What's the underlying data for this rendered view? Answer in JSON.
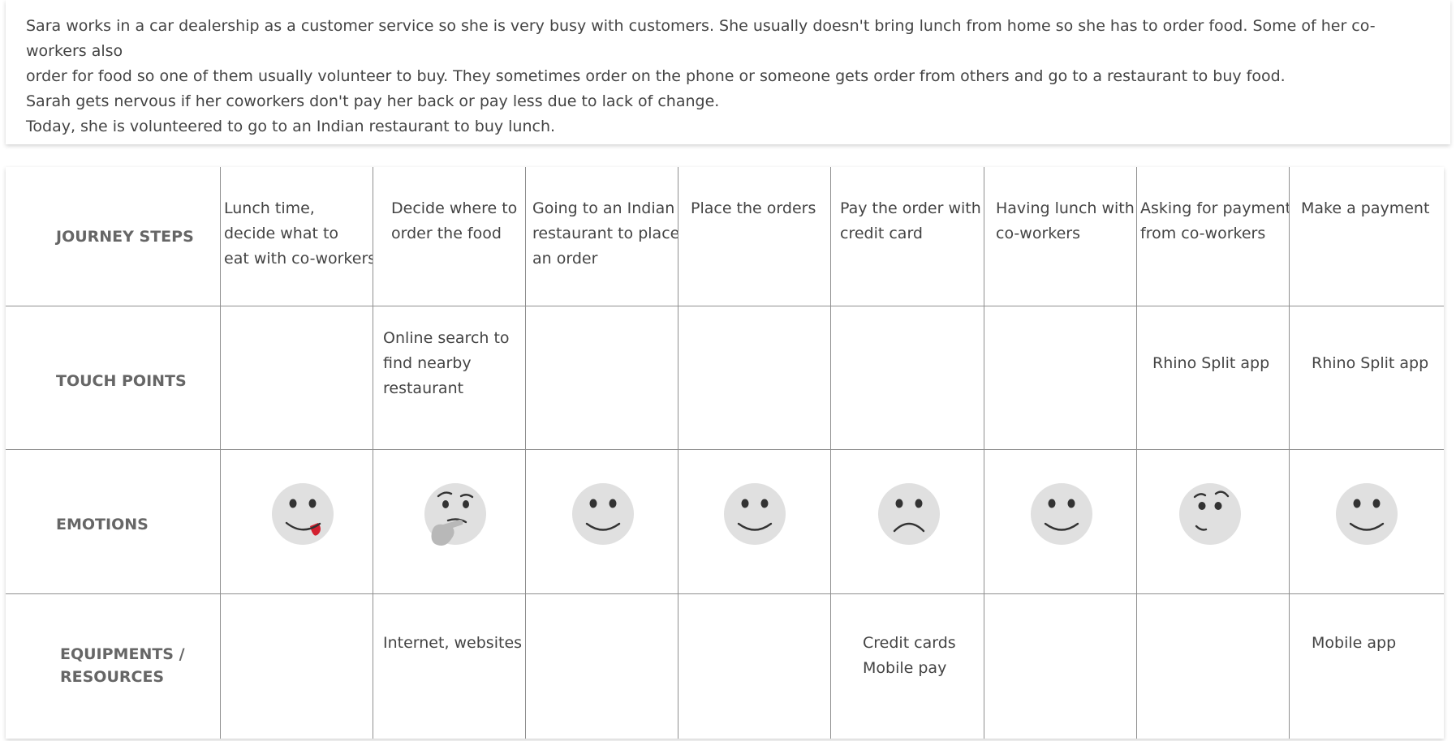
{
  "scenario": {
    "lines": [
      "Sara works in a car dealership as a customer service so she is very busy with customers. She usually doesn't bring lunch from home so she has to order food. Some of her co-workers also",
      "order for food so one of them usually volunteer to buy. They sometimes order on the phone or someone gets order from others and go to a restaurant to buy food.",
      "Sarah gets nervous if her coworkers don't pay her back or pay less due to lack of change.",
      "Today, she is volunteered to go to an Indian restaurant to buy lunch."
    ]
  },
  "journey_map": {
    "row_labels": {
      "journey_steps": "JOURNEY STEPS",
      "touch_points": "TOUCH POINTS",
      "emotions": "EMOTIONS",
      "equipments_line1": "EQUIPMENTS /",
      "equipments_line2": "RESOURCES"
    },
    "steps": [
      {
        "lines": [
          "Lunch time,",
          "decide what to",
          "eat with co-workers"
        ]
      },
      {
        "lines": [
          "Decide where to",
          "order the food"
        ]
      },
      {
        "lines": [
          "Going to an Indian",
          "restaurant to place",
          "an order"
        ]
      },
      {
        "lines": [
          "Place the orders"
        ]
      },
      {
        "lines": [
          "Pay the order with",
          "credit card"
        ]
      },
      {
        "lines": [
          "Having lunch with",
          "co-workers"
        ]
      },
      {
        "lines": [
          "Asking for payment",
          "from co-workers"
        ]
      },
      {
        "lines": [
          "Make a payment"
        ]
      }
    ],
    "touch_points": [
      {
        "lines": []
      },
      {
        "lines": [
          "Online search to",
          "find nearby",
          "restaurant"
        ]
      },
      {
        "lines": []
      },
      {
        "lines": []
      },
      {
        "lines": []
      },
      {
        "lines": []
      },
      {
        "lines": [
          "Rhino Split app"
        ]
      },
      {
        "lines": [
          "Rhino Split app"
        ]
      }
    ],
    "emotions": [
      {
        "icon": "tongue-out-face-icon"
      },
      {
        "icon": "thinking-face-icon"
      },
      {
        "icon": "smiling-face-icon"
      },
      {
        "icon": "smiling-face-icon"
      },
      {
        "icon": "frowning-face-icon"
      },
      {
        "icon": "smiling-face-icon"
      },
      {
        "icon": "face-with-raised-eyebrow-icon"
      },
      {
        "icon": "smiling-face-icon"
      }
    ],
    "equipments": [
      {
        "lines": []
      },
      {
        "lines": [
          "Internet, websites"
        ]
      },
      {
        "lines": []
      },
      {
        "lines": []
      },
      {
        "lines": [
          "Credit cards",
          "Mobile pay"
        ]
      },
      {
        "lines": []
      },
      {
        "lines": []
      },
      {
        "lines": [
          "Mobile app"
        ]
      }
    ],
    "colors": {
      "face_fill": "#e0e0e0",
      "face_features": "#333333",
      "tongue": "#d3202f",
      "hand": "#b8b8b8",
      "grid_line": "#8f8f8f",
      "row_label": "#666666"
    }
  }
}
